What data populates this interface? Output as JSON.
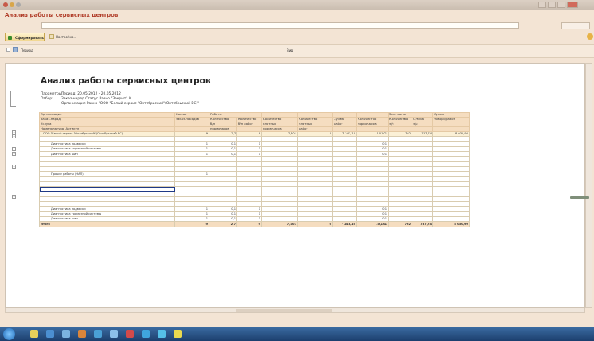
{
  "window": {
    "title": ""
  },
  "app": {
    "header": "Анализ работы сервисных центров",
    "option_label": "",
    "option_value": "",
    "option_button": "",
    "form_button": "Сформировать",
    "settings_button": "Настройка...",
    "actions_menu": ""
  },
  "period_bar": {
    "left_label": "Период",
    "right_label": "Вид"
  },
  "report": {
    "title": "Анализ работы сервисных центров",
    "params": {
      "params_label": "Параметры:",
      "period_text": "Период: 20.05.2012 - 20.05.2012",
      "filter_label": "Отбор:",
      "filter_line1": "Заказ-наряд.Статус Равно \"Закрыт\" И",
      "filter_line2": "Организация Равно \"ООО \"Белый сервис \"Октябрьский\"(Октябрьский БС)\""
    },
    "headers": {
      "h_org": "Организация",
      "h_order": "Заказ-наряд",
      "h_service": "Услуга",
      "h_item": "Номенклатура, Артикул",
      "h_qty": "Кол-во",
      "h_qty2": "заказ-нарядов",
      "h_works": "Работы",
      "h_c1": "Количество",
      "h_c1b": "б/п",
      "h_c1c": "нормочасов",
      "h_c2": "Количество",
      "h_c2b": "б/п работ",
      "h_c3": "Количество",
      "h_c3b": "платных",
      "h_c3c": "нормочасов",
      "h_c4": "Количество",
      "h_c4b": "платных",
      "h_c4c": "работ",
      "h_c5": "Сумма",
      "h_c5b": "работ",
      "h_c6": "Количество",
      "h_c6b": "нормочасов",
      "h_parts": "Зап. части",
      "h_c7": "Количество",
      "h_c7b": "з/ч",
      "h_c8": "Сумма",
      "h_c8b": "з/ч",
      "h_c9": "Сумма",
      "h_c9b": "товаро/работ"
    },
    "rows": [
      {
        "name": "ООО \"Белый сервис \"Октябрьский\"(Октябрьский БС)",
        "c": [
          "9",
          "2,7",
          "9",
          "7,401",
          "6",
          "7 243,16",
          "10,101",
          "762",
          "787,74",
          "8 030,90"
        ]
      },
      {
        "name": "",
        "c": [
          "",
          "",
          "",
          "",
          "",
          "",
          "",
          "",
          "",
          ""
        ]
      },
      {
        "name": "Диагностика подвески",
        "c": [
          "1",
          "0,1",
          "1",
          "",
          "",
          "",
          "0,1",
          "",
          "",
          ""
        ]
      },
      {
        "name": "Диагностика тормозной системы",
        "c": [
          "1",
          "0,1",
          "1",
          "",
          "",
          "",
          "0,1",
          "",
          "",
          ""
        ]
      },
      {
        "name": "Диагностика шин",
        "c": [
          "1",
          "0,1",
          "1",
          "",
          "",
          "",
          "0,1",
          "",
          "",
          ""
        ]
      },
      {
        "name": "",
        "c": [
          "",
          "",
          "",
          "",
          "",
          "",
          "",
          "",
          "",
          ""
        ]
      },
      {
        "name": "",
        "c": [
          "",
          "",
          "",
          "",
          "",
          "",
          "",
          "",
          "",
          ""
        ]
      },
      {
        "name": "",
        "c": [
          "",
          "",
          "",
          "",
          "",
          "",
          "",
          "",
          "",
          ""
        ]
      },
      {
        "name": "Прочие работы (НАЛ)",
        "c": [
          "1",
          "",
          "",
          "",
          "",
          "",
          "",
          "",
          "",
          ""
        ]
      },
      {
        "name": "",
        "c": [
          "",
          "",
          "",
          "",
          "",
          "",
          "",
          "",
          "",
          ""
        ]
      },
      {
        "name": "",
        "c": [
          "",
          "",
          "",
          "",
          "",
          "",
          "",
          "",
          "",
          ""
        ]
      },
      {
        "name": "",
        "c": [
          "",
          "",
          "",
          "",
          "",
          "",
          "",
          "",
          "",
          ""
        ]
      },
      {
        "name": "",
        "c": [
          "",
          "",
          "",
          "",
          "",
          "",
          "",
          "",
          "",
          ""
        ]
      },
      {
        "name": "",
        "c": [
          "",
          "",
          "",
          "",
          "",
          "",
          "",
          "",
          "",
          ""
        ]
      },
      {
        "name": "",
        "c": [
          "",
          "",
          "",
          "",
          "",
          "",
          "",
          "",
          "",
          ""
        ]
      },
      {
        "name": "Диагностика подвески",
        "c": [
          "1",
          "0,1",
          "1",
          "",
          "",
          "",
          "0,1",
          "",
          "",
          ""
        ]
      },
      {
        "name": "Диагностика тормозной системы",
        "c": [
          "1",
          "0,1",
          "1",
          "",
          "",
          "",
          "0,1",
          "",
          "",
          ""
        ]
      },
      {
        "name": "Диагностика шин",
        "c": [
          "1",
          "0,1",
          "1",
          "",
          "",
          "",
          "0,1",
          "",
          "",
          ""
        ]
      }
    ],
    "total": {
      "name": "Итого",
      "c": [
        "9",
        "2,7",
        "9",
        "7,401",
        "6",
        "7 243,16",
        "10,101",
        "762",
        "787,74",
        "8 030,90"
      ]
    }
  },
  "taskbar": {
    "clock": ""
  },
  "colors": {
    "app_title": "#b03c28",
    "header_bg": "#f5ddc0",
    "org_bg": "#fbf0d6",
    "selection": "#1f3a86"
  }
}
